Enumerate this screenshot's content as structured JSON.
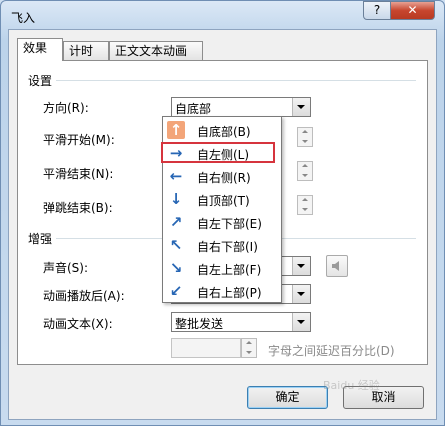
{
  "window": {
    "title": "飞入",
    "help_label": "?",
    "close_label": "✕"
  },
  "tabs": [
    {
      "label": "效果",
      "active": true
    },
    {
      "label": "计时",
      "active": false
    },
    {
      "label": "正文文本动画",
      "active": false
    }
  ],
  "settings": {
    "group_label": "设置",
    "direction_label": "方向(R):",
    "direction_value": "自底部",
    "smooth_start_label": "平滑开始(M):",
    "smooth_end_label": "平滑结束(N):",
    "bounce_end_label": "弹跳结束(B):"
  },
  "direction_dropdown": {
    "items": [
      {
        "label": "自底部(B)",
        "icon": "arrow-up-icon",
        "glyph": "↑"
      },
      {
        "label": "自左侧(L)",
        "icon": "arrow-right-icon",
        "glyph": "→"
      },
      {
        "label": "自右侧(R)",
        "icon": "arrow-left-icon",
        "glyph": "←"
      },
      {
        "label": "自顶部(T)",
        "icon": "arrow-down-icon",
        "glyph": "↓"
      },
      {
        "label": "自左下部(E)",
        "icon": "arrow-up-right-icon",
        "glyph": "↗"
      },
      {
        "label": "自右下部(I)",
        "icon": "arrow-up-left-icon",
        "glyph": "↖"
      },
      {
        "label": "自左上部(F)",
        "icon": "arrow-down-right-icon",
        "glyph": "↘"
      },
      {
        "label": "自右上部(P)",
        "icon": "arrow-down-left-icon",
        "glyph": "↙"
      }
    ],
    "selected_index": 0,
    "highlight_index": 1
  },
  "enhance": {
    "group_label": "增强",
    "sound_label": "声音(S):",
    "after_anim_label": "动画播放后(A):",
    "anim_text_label": "动画文本(X):",
    "anim_text_value": "整批发送",
    "letter_delay_label": "字母之间延迟百分比(D)"
  },
  "buttons": {
    "ok": "确定",
    "cancel": "取消"
  },
  "watermark": "Baidu 经验",
  "colors": {
    "highlight_border": "#d6343d",
    "selected_icon_bg": "#f3a579",
    "icon_blue": "#2766b4"
  }
}
